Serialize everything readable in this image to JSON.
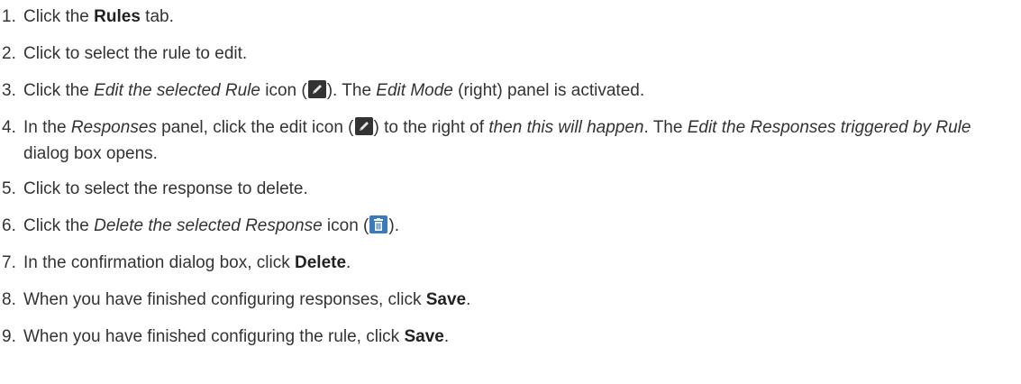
{
  "steps": [
    {
      "number": "1.",
      "parts": [
        "Click the ",
        "Rules",
        " tab."
      ]
    },
    {
      "number": "2.",
      "text": "Click to select the rule to edit."
    },
    {
      "number": "3.",
      "parts": [
        "Click the ",
        "Edit the selected Rule",
        " icon (",
        "). The ",
        "Edit Mode",
        " (right) panel is activated."
      ]
    },
    {
      "number": "4.",
      "parts": [
        "In the ",
        "Responses",
        " panel, click the edit icon (",
        ") to the right of ",
        "then this will happen",
        ". The ",
        "Edit the Responses triggered by Rule",
        " dialog box opens."
      ]
    },
    {
      "number": "5.",
      "text": "Click to select the response to delete."
    },
    {
      "number": "6.",
      "parts": [
        "Click the ",
        "Delete the selected Response",
        " icon (",
        ")."
      ]
    },
    {
      "number": "7.",
      "parts": [
        "In the confirmation dialog box, click ",
        "Delete",
        "."
      ]
    },
    {
      "number": "8.",
      "parts": [
        "When you have finished configuring responses, click ",
        "Save",
        "."
      ]
    },
    {
      "number": "9.",
      "parts": [
        "When you have finished configuring the rule, click ",
        "Save",
        "."
      ]
    }
  ],
  "icons": {
    "edit": "pencil-icon",
    "delete": "trash-icon",
    "edit_bg": "#333333",
    "delete_bg": "#3a7bbf"
  }
}
